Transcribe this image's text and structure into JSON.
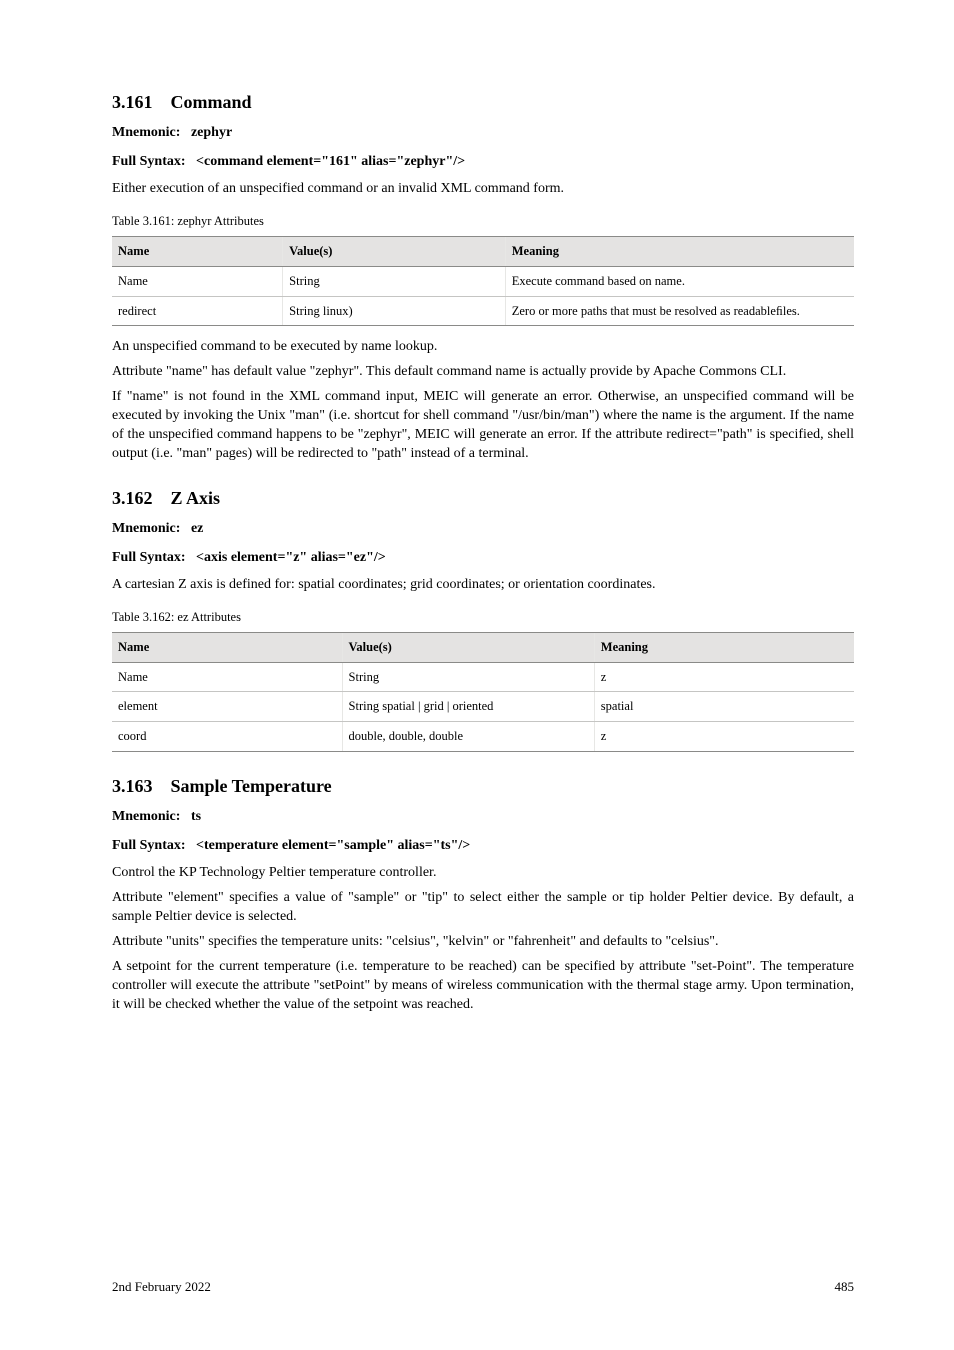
{
  "heading": {
    "section_number": "3.161",
    "section_text": "Command",
    "mnemonic_label": "Mnemonic:",
    "mnemonic_value": "zephyr",
    "full_label": "Full Syntax:",
    "full_value": "<command element=\"161\"  alias=\"zephyr\"/>",
    "summary": "Either execution of an unspecified command or an invalid XML command form."
  },
  "table1": {
    "caption": "Table 3.161: zephyr Attributes",
    "headers": [
      "Name",
      "Value(s)",
      "Meaning"
    ],
    "rows": [
      [
        "Name",
        "String",
        "Execute command based on name."
      ],
      [
        "redirect",
        "String linux)",
        "Zero or more paths that must be resolved as readableﬁles."
      ]
    ]
  },
  "para1": "An unspecified command to be executed by name lookup.",
  "para2": "Attribute \"name\" has default value \"zephyr\". This default command name is actually provide by Apache Commons CLI.",
  "para3": "If \"name\" is not found in the XML command input, MEIC will generate an error. Otherwise, an unspecified command will be executed by invoking the Unix \"man\" (i.e. shortcut for shell command \"/usr/bin/man\") where the name is the argument. If the name of the unspecified command happens to be \"zephyr\", MEIC will generate an error. If the attribute redirect=\"path\" is specified, shell output (i.e. \"man\" pages) will be redirected to \"path\" instead of a terminal.",
  "heading2": {
    "section_number": "3.162",
    "section_text": "Z Axis",
    "mnemonic_label": "Mnemonic:",
    "mnemonic_value": "ez",
    "full_label": "Full Syntax:",
    "full_value": "<axis element=\"z\"  alias=\"ez\"/>",
    "summary": "A cartesian Z axis is defined for: spatial coordinates; grid coordinates; or orientation coordinates."
  },
  "table2": {
    "caption": "Table 3.162: ez Attributes",
    "headers": [
      "Name",
      "Value(s)",
      "Meaning"
    ],
    "rows": [
      [
        "Name",
        "String",
        "z"
      ],
      [
        "element",
        "String spatial | grid | oriented",
        "spatial"
      ],
      [
        "coord",
        "double, double, double",
        "z"
      ]
    ]
  },
  "heading3": {
    "section_number": "3.163",
    "section_text": "Sample Temperature",
    "mnemonic_label": "Mnemonic:",
    "mnemonic_value": "ts",
    "full_label": "Full Syntax:",
    "full_value": "<temperature element=\"sample\"  alias=\"ts\"/>",
    "summary": "Control the KP Technology Peltier temperature controller."
  },
  "para4": "Attribute \"element\" specifies a value of \"sample\" or \"tip\" to select either the sample or tip holder Peltier device. By default, a sample Peltier device is selected.",
  "para5": "Attribute \"units\" specifies the temperature units: \"celsius\", \"kelvin\" or \"fahrenheit\" and defaults to \"celsius\".",
  "para6": "A setpoint for the current temperature (i.e. temperature to be reached) can be specified by attribute \"set-Point\". The temperature controller will execute the attribute \"setPoint\" by means of wireless communication with the thermal stage army. Upon termination, it will be checked whether the value of the setpoint was reached.",
  "footer": {
    "left": "2nd February 2022",
    "right": "485"
  }
}
